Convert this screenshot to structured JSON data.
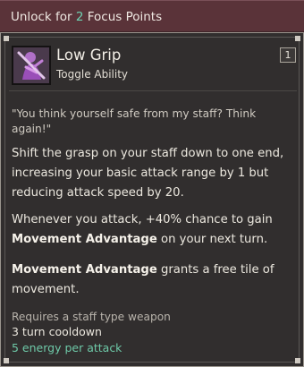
{
  "banner": {
    "prefix": "Unlock for",
    "points": "2",
    "suffix": "Focus Points"
  },
  "ability": {
    "name": "Low Grip",
    "type": "Toggle Ability",
    "slot_badge": "1",
    "icon": "purple-figure-with-staff-icon",
    "quote": "\"You think yourself safe from my staff? Think again!\"",
    "description": "Shift the grasp on your staff down to one end, increasing your basic attack range by 1 but reducing attack speed by 20.",
    "effect": {
      "before": "Whenever you attack, +40% chance to gain",
      "keyword": "Movement Advantage",
      "after": "on your next turn."
    },
    "keyword_def": {
      "keyword": "Movement Advantage",
      "text": "grants a free tile of movement."
    },
    "requirement": "Requires a staff type weapon",
    "cooldown": "3 turn cooldown",
    "energy": "5 energy per attack"
  },
  "colors": {
    "banner_bg": "#5a3339",
    "panel_bg": "#312e2e",
    "accent_green": "#6ec9a8"
  }
}
